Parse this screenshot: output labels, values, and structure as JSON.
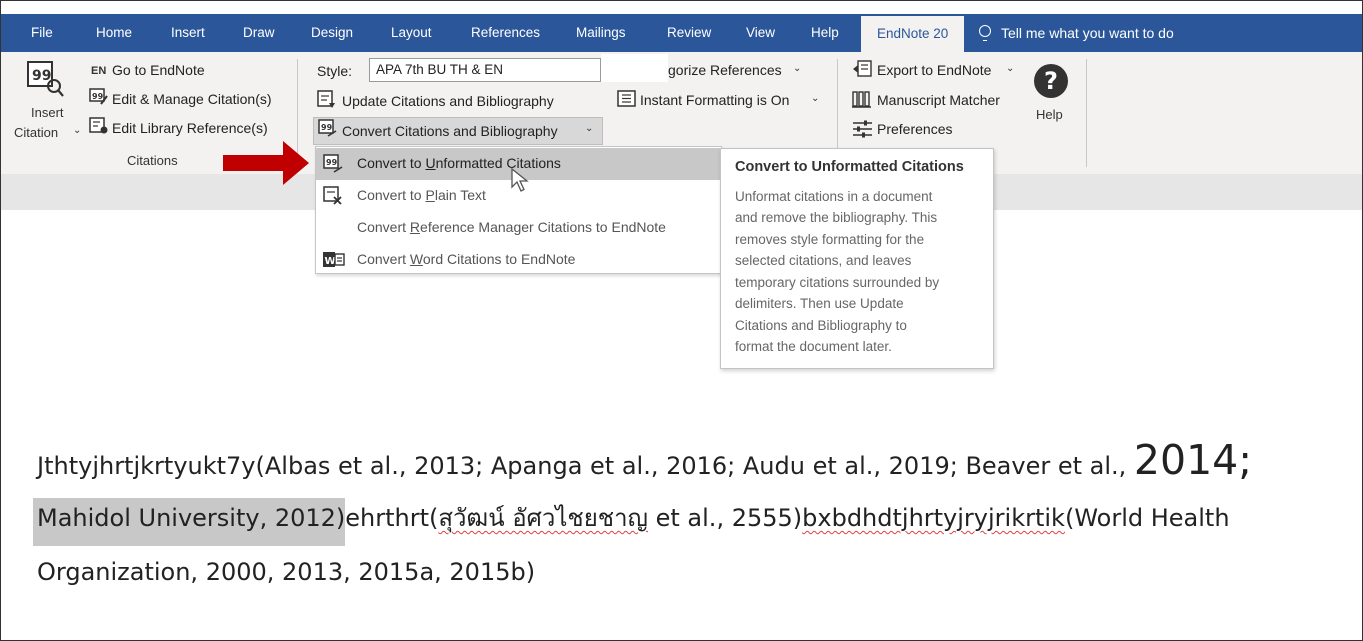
{
  "tabs": {
    "file": "File",
    "home": "Home",
    "insert": "Insert",
    "draw": "Draw",
    "design": "Design",
    "layout": "Layout",
    "references": "References",
    "mailings": "Mailings",
    "review": "Review",
    "view": "View",
    "help": "Help",
    "endnote": "EndNote 20",
    "tell_me": "Tell me what you want to do"
  },
  "ribbon": {
    "insert_citation_line1": "Insert",
    "insert_citation_line2": "Citation",
    "go_to_endnote": "Go to EndNote",
    "en_badge": "EN",
    "edit_manage": "Edit & Manage Citation(s)",
    "edit_library": "Edit Library Reference(s)",
    "citations_group": "Citations",
    "style_label": "Style:",
    "style_value": "APA 7th BU TH & EN",
    "categorize": "gorize References",
    "update_citations": "Update Citations and Bibliography",
    "instant_formatting": "Instant Formatting is On",
    "convert_citations": "Convert Citations and Bibliography",
    "export": "Export to EndNote",
    "manuscript": "Manuscript Matcher",
    "preferences": "Preferences",
    "help": "Help"
  },
  "menu": {
    "items": [
      {
        "prefix": "Convert to ",
        "key": "U",
        "rest": "nformatted Citations"
      },
      {
        "prefix": "Convert to ",
        "key": "P",
        "rest": "lain Text"
      },
      {
        "prefix": "Convert ",
        "key": "R",
        "rest": "eference Manager Citations to EndNote"
      },
      {
        "prefix": "Convert ",
        "key": "W",
        "rest": "ord Citations to EndNote"
      }
    ]
  },
  "tooltip": {
    "title": "Convert to Unformatted Citations",
    "lines": [
      "Unformat citations in a document",
      "and remove the bibliography. This",
      "removes style formatting for the",
      "selected citations, and leaves",
      "temporary citations surrounded by",
      "delimiters. Then use Update",
      "Citations and Bibliography to",
      "format the document later."
    ]
  },
  "document": {
    "line1_a": "Jthtyjhrtjkrtyukt7y(Albas et al., 2013; Apanga et al., 2016; Audu et al., 2019; Beaver et al., ",
    "line1_big": "2014;",
    "line2_selected": "Mahidol University, 2012)",
    "line2_b": "ehrthrt(",
    "line2_thai": "สุวัฒน์ อัศวไชยชาญ",
    "line2_c": " et al., 2555)",
    "line2_d": "bxbdhdtjhrtyjryjrikrtik",
    "line2_e": "(World Health",
    "line3": "Organization, 2000, 2013, 2015a, 2015b)"
  },
  "colors": {
    "tabbar": "#2b579a",
    "ribbon": "#f3f2f1",
    "highlight": "#c8c8c8",
    "arrow": "#c00000"
  }
}
